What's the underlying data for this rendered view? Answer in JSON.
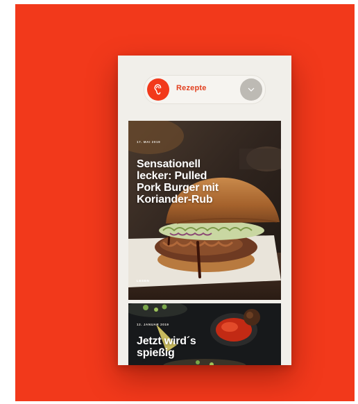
{
  "header": {
    "logo_icon": "ear-icon",
    "section_label": "Rezepte",
    "toggle_icon": "chevron-down-icon"
  },
  "articles": [
    {
      "date": "17. MAI 2019",
      "title": "Sensationell lecker: Pulled Pork Burger mit Koriander-Rub",
      "category": "LESEN"
    },
    {
      "date": "12. JANUAR 2019",
      "title": "Jetzt wird´s spießig"
    }
  ],
  "colors": {
    "accent": "#f2391b",
    "page_background": "#f1efea",
    "toggle": "#bdbab4"
  }
}
